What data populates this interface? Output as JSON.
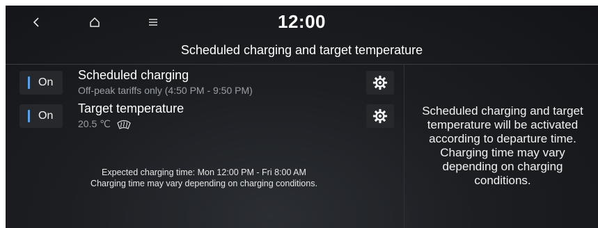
{
  "header": {
    "clock": "12:00",
    "title": "Scheduled charging and target temperature"
  },
  "nav": {
    "back_icon": "chevron-left-icon",
    "home_icon": "home-icon",
    "menu_icon": "menu-icon"
  },
  "rows": [
    {
      "toggle_label": "On",
      "title": "Scheduled charging",
      "subtitle": "Off-peak tariffs only (4:50 PM - 9:50 PM)"
    },
    {
      "toggle_label": "On",
      "title": "Target temperature",
      "subtitle": "20.5 ℃"
    }
  ],
  "info": {
    "line1": "Expected charging time: Mon 12:00 PM - Fri 8:00 AM",
    "line2": "Charging time may vary depending on charging conditions."
  },
  "side_panel": {
    "lines": [
      "Scheduled charging and target",
      "temperature will be activated",
      "according to departure time.",
      "Charging time may vary",
      "depending on charging",
      "conditions."
    ]
  },
  "colors": {
    "accent": "#4aa3ff",
    "background": "#1c1e22"
  }
}
